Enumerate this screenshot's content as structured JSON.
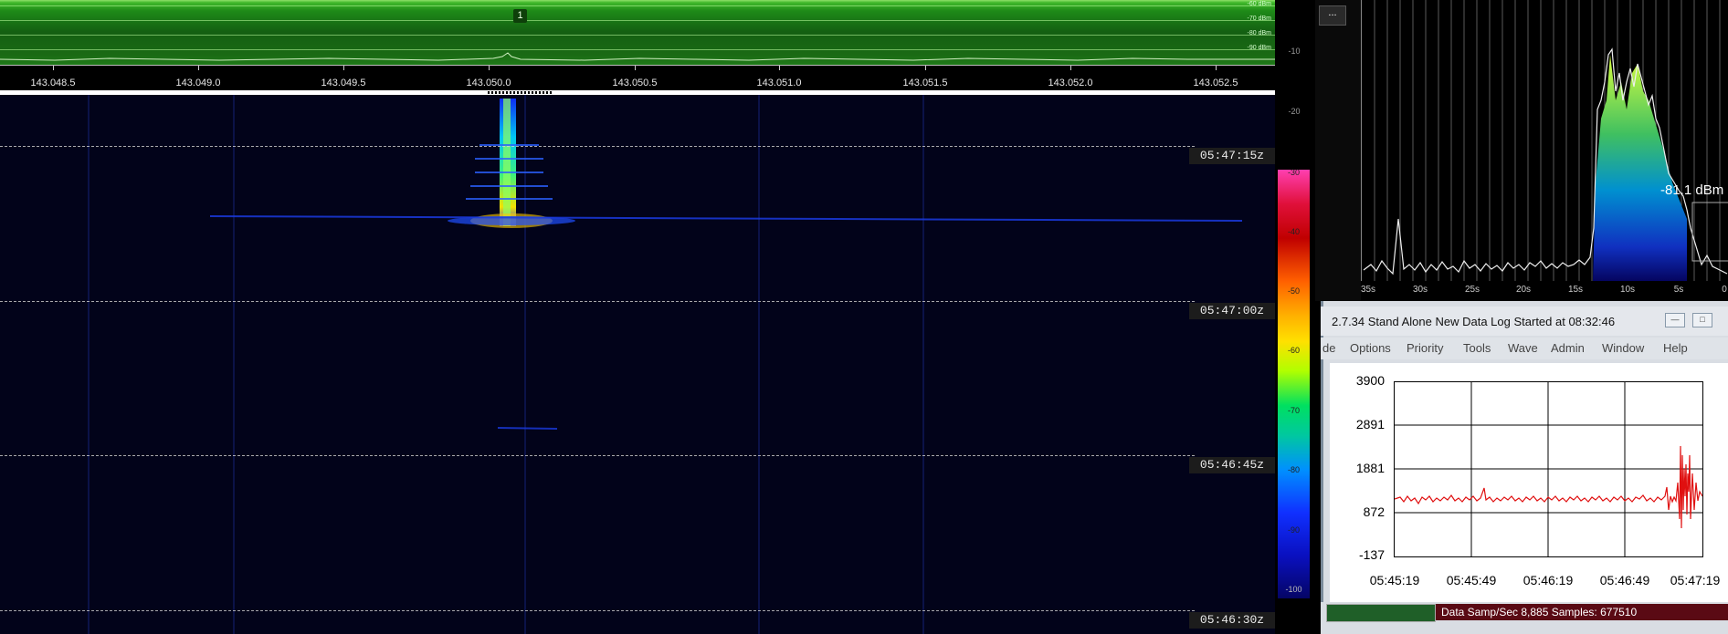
{
  "spectrum": {
    "marker_label": "1",
    "db_labels": [
      "-60 dBm",
      "-70 dBm",
      "-80 dBm",
      "-90 dBm"
    ],
    "frequencies": [
      "143.048.5",
      "143.049.0",
      "143.049.5",
      "143.050.0",
      "143.050.5",
      "143.051.0",
      "143.051.5",
      "143.052.0",
      "143.052.5"
    ]
  },
  "waterfall": {
    "timestamps": [
      "05:47:15z",
      "05:47:00z",
      "05:46:45z",
      "05:46:30z"
    ]
  },
  "db_scale": {
    "labels": [
      "-10",
      "-20",
      "-30",
      "-40",
      "-50",
      "-60",
      "-70",
      "-80",
      "-90",
      "-100"
    ]
  },
  "history": {
    "button_label": "...",
    "time_ticks": [
      "35s",
      "30s",
      "25s",
      "20s",
      "15s",
      "10s",
      "5s",
      "0"
    ],
    "level_readout": "-81.1 dBm"
  },
  "logger": {
    "title": "2.7.34   Stand Alone   New Data Log Started at 08:32:46",
    "menu": [
      "de",
      "Options",
      "Priority",
      "Tools",
      "Wave",
      "Admin",
      "Window",
      "Help"
    ],
    "y_labels": [
      "3900",
      "2891",
      "1881",
      "872",
      "-137"
    ],
    "x_labels": [
      "05:45:19",
      "05:45:49",
      "05:46:19",
      "05:46:49",
      "05:47:19"
    ],
    "status": "Data Samp/Sec 8,885   Samples:  677510",
    "colors": {
      "trace": "#e01010",
      "status_bg": "#5a0a14",
      "ok_box": "#1f5f28"
    }
  }
}
